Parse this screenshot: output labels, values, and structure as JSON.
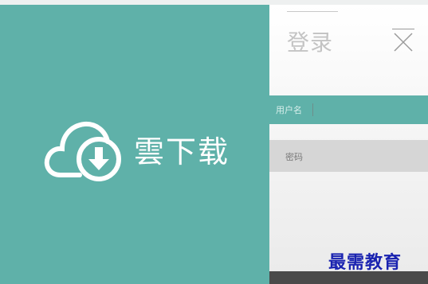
{
  "top_strip": {
    "text": ""
  },
  "brand": {
    "logo_icon": "cloud-download-icon",
    "name": "雲下载",
    "bg_color": "#5fb1a9"
  },
  "login": {
    "title": "登录",
    "close_icon": "close-icon",
    "username_placeholder": "用户名",
    "password_placeholder": "密码"
  },
  "watermark": {
    "text": "最需教育"
  },
  "colors": {
    "accent": "#5fb1a9",
    "watermark": "#1a23b0"
  }
}
